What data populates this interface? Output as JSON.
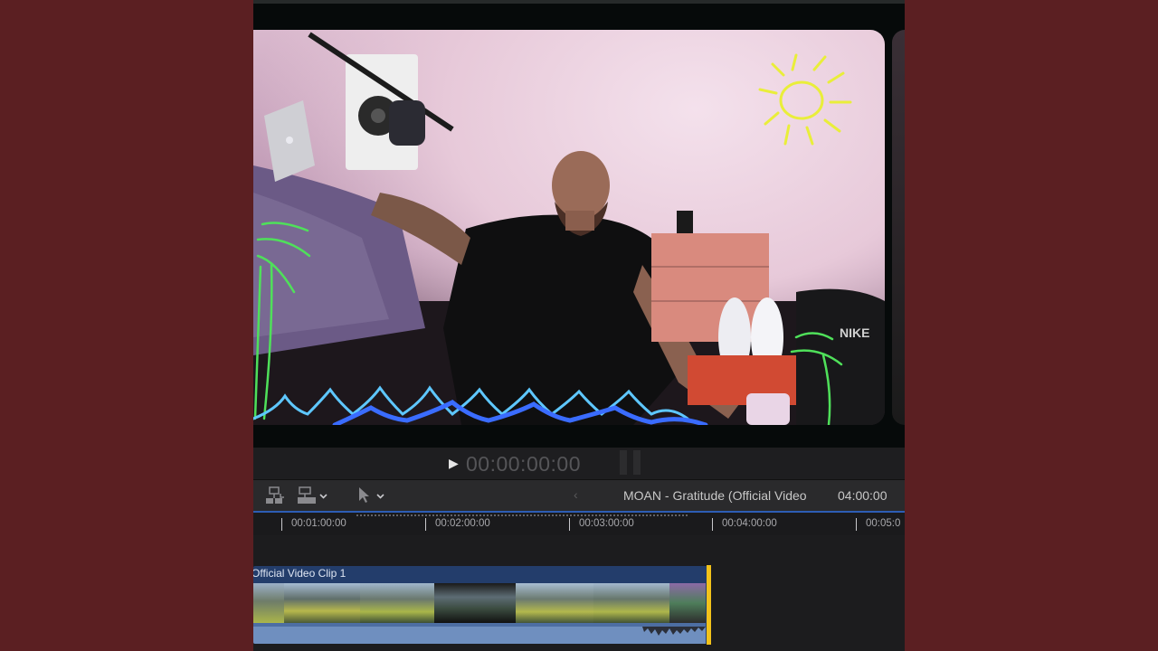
{
  "viewer": {
    "timecode": "00:00:00:00",
    "play_label": "▶"
  },
  "toolbar": {
    "project_title": "MOAN - Gratitude (Official Video",
    "project_duration": "04:00:00",
    "back_arrow": "‹"
  },
  "ruler": {
    "ticks": [
      "00:01:00:00",
      "00:02:00:00",
      "00:03:00:00",
      "00:04:00:00",
      "00:05:0"
    ]
  },
  "timeline": {
    "clip_label": "Official Video Clip 1"
  },
  "colors": {
    "background": "#5b1f22",
    "playhead_handle": "#f2c21a",
    "clip": "#233d6b",
    "ruler_accent": "#2d5db5"
  }
}
